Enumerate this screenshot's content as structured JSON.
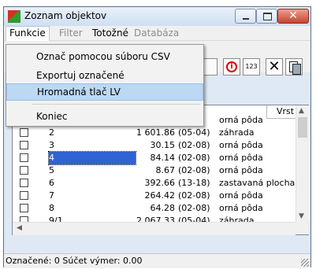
{
  "window": {
    "title": "Zoznam objektov"
  },
  "menubar": {
    "funkcie": "Funkcie",
    "filter": "Filter",
    "totozne": "Totožné",
    "databaza": "Databáza"
  },
  "dropdown": {
    "items": [
      "Označ pomocou súboru CSV",
      "Exportuj označené",
      "Hromadná tlač  LV",
      "Koniec"
    ]
  },
  "toolbar": {
    "icons": [
      "lock-icon",
      "info-icon",
      "123",
      "delete-icon",
      "copy-icon"
    ]
  },
  "grid": {
    "columns": {
      "vrst": "Vrst"
    },
    "rows": [
      {
        "id": "",
        "area": "",
        "code": "",
        "type": "orná pôda"
      },
      {
        "id": "2",
        "area": "1 601.86",
        "code": "(05-04)",
        "type": "záhrada"
      },
      {
        "id": "3",
        "area": "30.15",
        "code": "(02-08)",
        "type": "orná pôda"
      },
      {
        "id": "4",
        "area": "84.14",
        "code": "(02-08)",
        "type": "orná pôda"
      },
      {
        "id": "5",
        "area": "8.67",
        "code": "(02-08)",
        "type": "orná pôda"
      },
      {
        "id": "6",
        "area": "392.66",
        "code": "(13-18)",
        "type": "zastavaná plocha"
      },
      {
        "id": "7",
        "area": "264.42",
        "code": "(02-08)",
        "type": "orná pôda"
      },
      {
        "id": "8",
        "area": "64.28",
        "code": "(02-08)",
        "type": "orná pôda"
      },
      {
        "id": "9/1",
        "area": "2 067.33",
        "code": "(05-04)",
        "type": "záhrada"
      }
    ]
  },
  "status": {
    "text": "Označené: 0   Súčet výmer: 0.00"
  },
  "colors": {
    "selection": "#2f63d3",
    "menu_highlight": "#bcd8f3",
    "close": "#c8452e"
  }
}
